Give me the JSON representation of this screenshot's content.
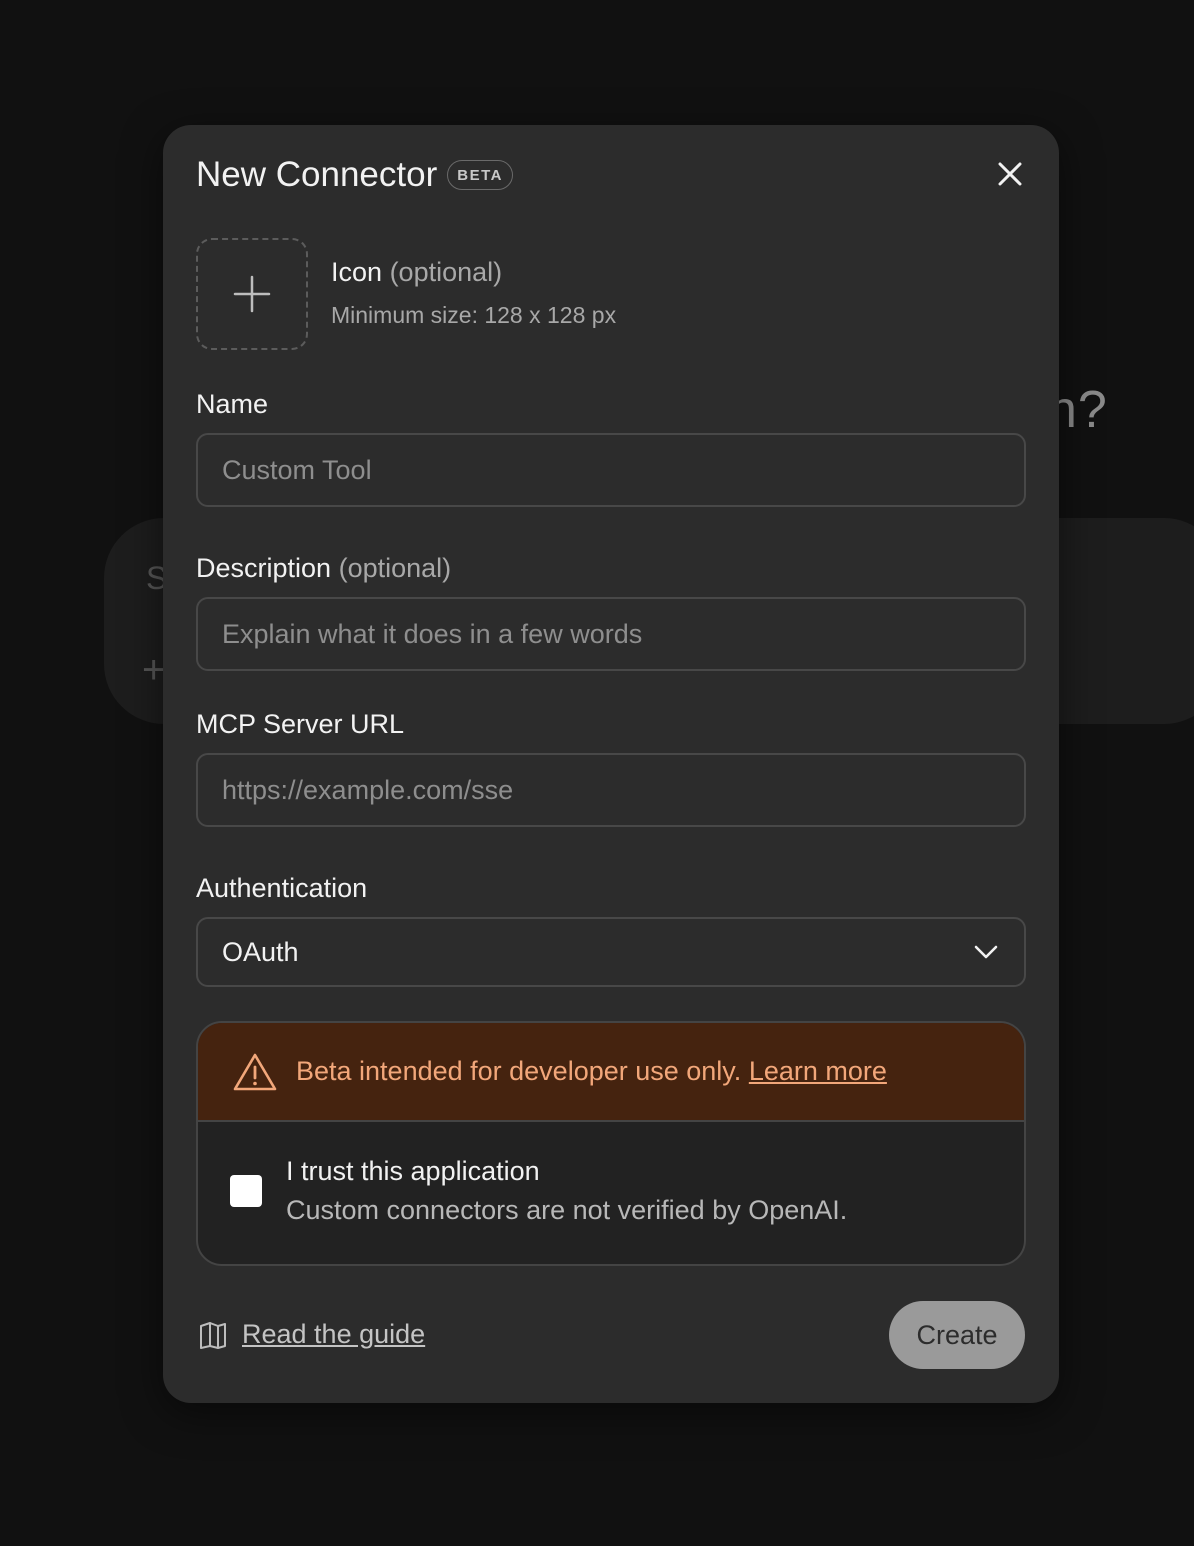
{
  "background": {
    "heading_fragment": "n?",
    "card_text_fragment": "S",
    "card_plus": "+"
  },
  "dialog": {
    "title": "New Connector",
    "badge": "BETA",
    "close_icon": "close-icon"
  },
  "icon_upload": {
    "label": "Icon",
    "optional": "(optional)",
    "hint": "Minimum size: 128 x 128 px",
    "icon": "plus-icon"
  },
  "name_field": {
    "label": "Name",
    "placeholder": "Custom Tool",
    "value": ""
  },
  "description_field": {
    "label": "Description",
    "optional": "(optional)",
    "placeholder": "Explain what it does in a few words",
    "value": ""
  },
  "url_field": {
    "label": "MCP Server URL",
    "placeholder": "https://example.com/sse",
    "value": ""
  },
  "authentication": {
    "label": "Authentication",
    "selected": "OAuth",
    "icon": "chevron-down-icon"
  },
  "warning": {
    "icon": "warning-triangle-icon",
    "text": "Beta intended for developer use only.",
    "link": "Learn more",
    "color": "#f2a77a",
    "background": "#45230f"
  },
  "trust": {
    "checked": false,
    "title": "I trust this application",
    "subtitle": "Custom connectors are not verified by OpenAI."
  },
  "footer": {
    "guide_icon": "book-icon",
    "guide_link": "Read the guide",
    "create_button": "Create"
  }
}
